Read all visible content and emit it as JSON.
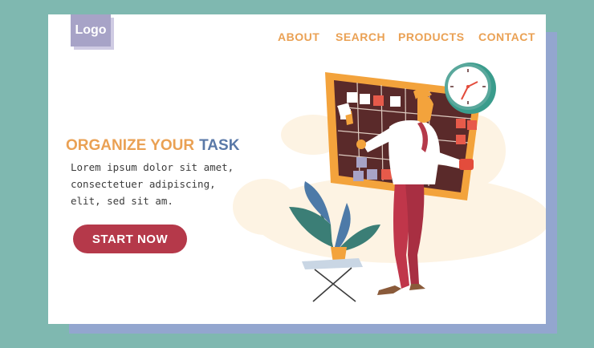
{
  "brand": {
    "logo_text": "Logo"
  },
  "nav": {
    "items": [
      {
        "label": "ABOUT"
      },
      {
        "label": "SEARCH"
      },
      {
        "label": "PRODUCTS"
      },
      {
        "label": "CONTACT"
      }
    ]
  },
  "hero": {
    "headline_part1": "ORGANIZE YOUR",
    "headline_part2": "TASK",
    "body_lines": [
      "Lorem ipsum dolor sit amet,",
      "consectetuer adipiscing,",
      "elit, sed sit am."
    ],
    "cta_label": "START NOW"
  },
  "colors": {
    "background": "#7fb8b0",
    "accent_orange": "#eaa154",
    "accent_blue": "#5a79a8",
    "cta": "#b5394a",
    "board": "#5a2a2a"
  },
  "illustration": {
    "icons": [
      "task-board-icon",
      "wall-clock-icon",
      "person-icon",
      "potted-plant-icon"
    ]
  }
}
